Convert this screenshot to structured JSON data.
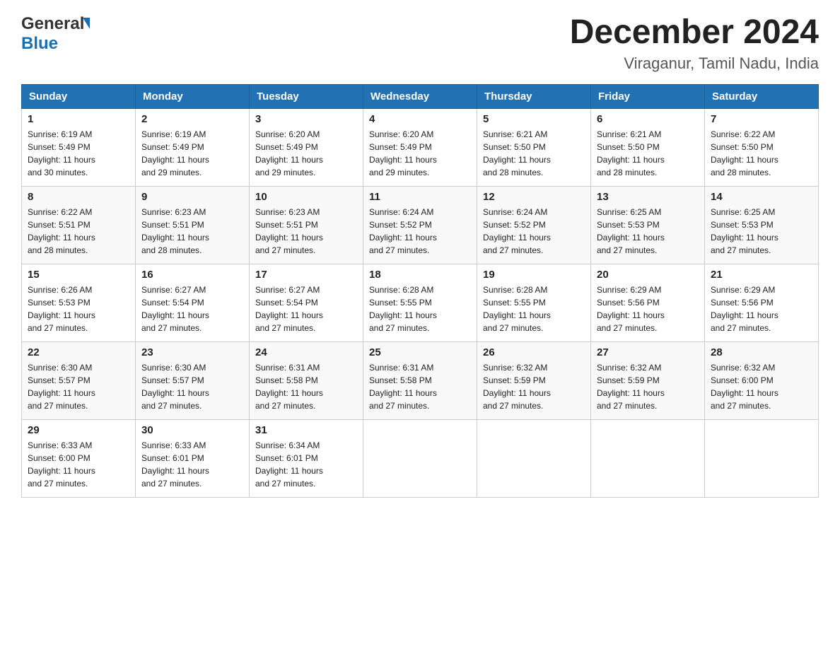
{
  "header": {
    "logo_general": "General",
    "logo_blue": "Blue",
    "title": "December 2024",
    "subtitle": "Viraganur, Tamil Nadu, India"
  },
  "weekdays": [
    "Sunday",
    "Monday",
    "Tuesday",
    "Wednesday",
    "Thursday",
    "Friday",
    "Saturday"
  ],
  "weeks": [
    [
      {
        "day": "1",
        "info": "Sunrise: 6:19 AM\nSunset: 5:49 PM\nDaylight: 11 hours\nand 30 minutes."
      },
      {
        "day": "2",
        "info": "Sunrise: 6:19 AM\nSunset: 5:49 PM\nDaylight: 11 hours\nand 29 minutes."
      },
      {
        "day": "3",
        "info": "Sunrise: 6:20 AM\nSunset: 5:49 PM\nDaylight: 11 hours\nand 29 minutes."
      },
      {
        "day": "4",
        "info": "Sunrise: 6:20 AM\nSunset: 5:49 PM\nDaylight: 11 hours\nand 29 minutes."
      },
      {
        "day": "5",
        "info": "Sunrise: 6:21 AM\nSunset: 5:50 PM\nDaylight: 11 hours\nand 28 minutes."
      },
      {
        "day": "6",
        "info": "Sunrise: 6:21 AM\nSunset: 5:50 PM\nDaylight: 11 hours\nand 28 minutes."
      },
      {
        "day": "7",
        "info": "Sunrise: 6:22 AM\nSunset: 5:50 PM\nDaylight: 11 hours\nand 28 minutes."
      }
    ],
    [
      {
        "day": "8",
        "info": "Sunrise: 6:22 AM\nSunset: 5:51 PM\nDaylight: 11 hours\nand 28 minutes."
      },
      {
        "day": "9",
        "info": "Sunrise: 6:23 AM\nSunset: 5:51 PM\nDaylight: 11 hours\nand 28 minutes."
      },
      {
        "day": "10",
        "info": "Sunrise: 6:23 AM\nSunset: 5:51 PM\nDaylight: 11 hours\nand 27 minutes."
      },
      {
        "day": "11",
        "info": "Sunrise: 6:24 AM\nSunset: 5:52 PM\nDaylight: 11 hours\nand 27 minutes."
      },
      {
        "day": "12",
        "info": "Sunrise: 6:24 AM\nSunset: 5:52 PM\nDaylight: 11 hours\nand 27 minutes."
      },
      {
        "day": "13",
        "info": "Sunrise: 6:25 AM\nSunset: 5:53 PM\nDaylight: 11 hours\nand 27 minutes."
      },
      {
        "day": "14",
        "info": "Sunrise: 6:25 AM\nSunset: 5:53 PM\nDaylight: 11 hours\nand 27 minutes."
      }
    ],
    [
      {
        "day": "15",
        "info": "Sunrise: 6:26 AM\nSunset: 5:53 PM\nDaylight: 11 hours\nand 27 minutes."
      },
      {
        "day": "16",
        "info": "Sunrise: 6:27 AM\nSunset: 5:54 PM\nDaylight: 11 hours\nand 27 minutes."
      },
      {
        "day": "17",
        "info": "Sunrise: 6:27 AM\nSunset: 5:54 PM\nDaylight: 11 hours\nand 27 minutes."
      },
      {
        "day": "18",
        "info": "Sunrise: 6:28 AM\nSunset: 5:55 PM\nDaylight: 11 hours\nand 27 minutes."
      },
      {
        "day": "19",
        "info": "Sunrise: 6:28 AM\nSunset: 5:55 PM\nDaylight: 11 hours\nand 27 minutes."
      },
      {
        "day": "20",
        "info": "Sunrise: 6:29 AM\nSunset: 5:56 PM\nDaylight: 11 hours\nand 27 minutes."
      },
      {
        "day": "21",
        "info": "Sunrise: 6:29 AM\nSunset: 5:56 PM\nDaylight: 11 hours\nand 27 minutes."
      }
    ],
    [
      {
        "day": "22",
        "info": "Sunrise: 6:30 AM\nSunset: 5:57 PM\nDaylight: 11 hours\nand 27 minutes."
      },
      {
        "day": "23",
        "info": "Sunrise: 6:30 AM\nSunset: 5:57 PM\nDaylight: 11 hours\nand 27 minutes."
      },
      {
        "day": "24",
        "info": "Sunrise: 6:31 AM\nSunset: 5:58 PM\nDaylight: 11 hours\nand 27 minutes."
      },
      {
        "day": "25",
        "info": "Sunrise: 6:31 AM\nSunset: 5:58 PM\nDaylight: 11 hours\nand 27 minutes."
      },
      {
        "day": "26",
        "info": "Sunrise: 6:32 AM\nSunset: 5:59 PM\nDaylight: 11 hours\nand 27 minutes."
      },
      {
        "day": "27",
        "info": "Sunrise: 6:32 AM\nSunset: 5:59 PM\nDaylight: 11 hours\nand 27 minutes."
      },
      {
        "day": "28",
        "info": "Sunrise: 6:32 AM\nSunset: 6:00 PM\nDaylight: 11 hours\nand 27 minutes."
      }
    ],
    [
      {
        "day": "29",
        "info": "Sunrise: 6:33 AM\nSunset: 6:00 PM\nDaylight: 11 hours\nand 27 minutes."
      },
      {
        "day": "30",
        "info": "Sunrise: 6:33 AM\nSunset: 6:01 PM\nDaylight: 11 hours\nand 27 minutes."
      },
      {
        "day": "31",
        "info": "Sunrise: 6:34 AM\nSunset: 6:01 PM\nDaylight: 11 hours\nand 27 minutes."
      },
      {
        "day": "",
        "info": ""
      },
      {
        "day": "",
        "info": ""
      },
      {
        "day": "",
        "info": ""
      },
      {
        "day": "",
        "info": ""
      }
    ]
  ]
}
